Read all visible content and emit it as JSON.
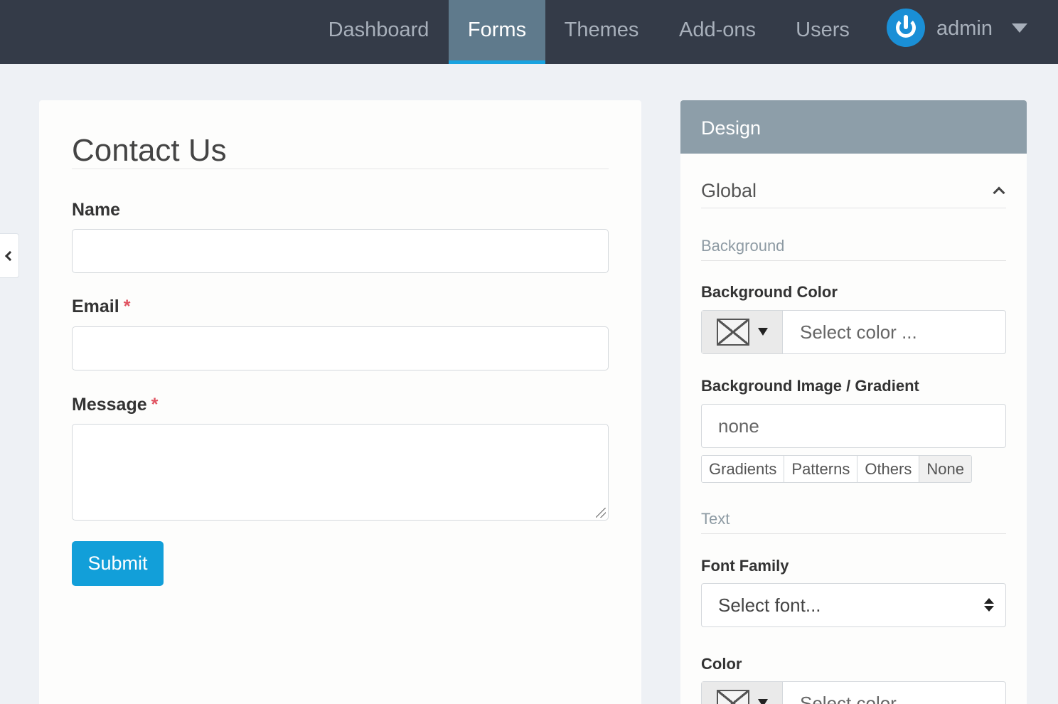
{
  "nav": {
    "items": [
      {
        "label": "Dashboard"
      },
      {
        "label": "Forms",
        "active": true
      },
      {
        "label": "Themes"
      },
      {
        "label": "Add-ons"
      },
      {
        "label": "Users"
      }
    ],
    "user": {
      "name": "admin",
      "logo_icon": "power-icon"
    }
  },
  "form": {
    "title": "Contact Us",
    "fields": {
      "name_label": "Name",
      "email_label": "Email",
      "message_label": "Message",
      "required_mark": "*"
    },
    "submit_label": "Submit"
  },
  "design": {
    "header": "Design",
    "section": "Global",
    "background_heading": "Background",
    "bg_color_label": "Background Color",
    "bg_color_placeholder": "Select color ...",
    "bg_image_label": "Background Image / Gradient",
    "bg_image_value": "none",
    "bg_buttons": [
      "Gradients",
      "Patterns",
      "Others",
      "None"
    ],
    "text_heading": "Text",
    "font_family_label": "Font Family",
    "font_placeholder": "Select font...",
    "color_label": "Color",
    "color_placeholder": "Select color ..."
  },
  "colors": {
    "nav_bg": "#343b48",
    "nav_active": "#5f7a8c",
    "accent": "#129fd9",
    "required": "#e05260",
    "panel_header": "#8d9ea9"
  }
}
